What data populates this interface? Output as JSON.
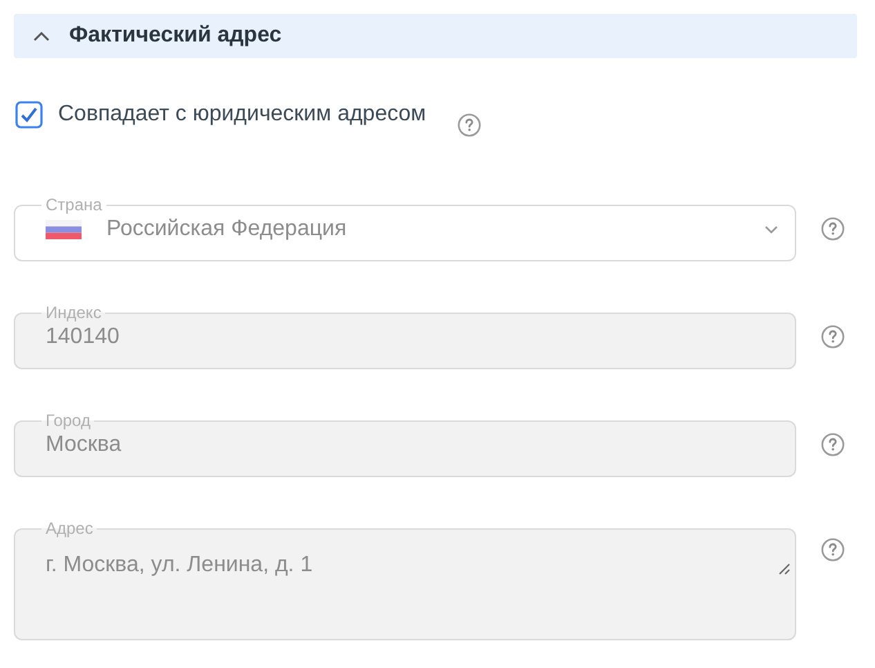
{
  "section": {
    "title": "Фактический адрес",
    "expanded": true
  },
  "same_as_legal": {
    "label": "Совпадает с юридическим адресом",
    "checked": true
  },
  "fields": [
    {
      "kind": "select",
      "label": "Страна",
      "value": "Российская Федерация",
      "disabled": true
    },
    {
      "kind": "input",
      "label": "Индекс",
      "value": "140140",
      "disabled": true
    },
    {
      "kind": "input",
      "label": "Город",
      "value": "Москва",
      "disabled": true
    },
    {
      "kind": "textarea",
      "label": "Адрес",
      "value": "г. Москва, ул. Ленина, д. 1",
      "disabled": true
    }
  ]
}
